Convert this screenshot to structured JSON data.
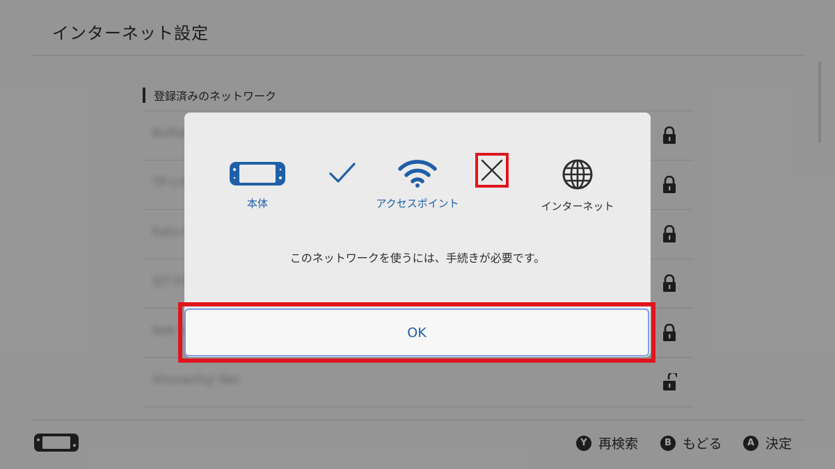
{
  "header": {
    "title": "インターネット設定"
  },
  "section": {
    "label": "登録済みのネットワーク"
  },
  "networks": [
    {
      "name": "Buffalo-G-XXXX",
      "lock": "locked"
    },
    {
      "name": "TP-Link_XXXX",
      "lock": "locked"
    },
    {
      "name": "Kato-Home",
      "lock": "locked"
    },
    {
      "name": "SJT-XXXX",
      "lock": "locked"
    },
    {
      "name": "Nak-XXXX",
      "lock": "locked"
    },
    {
      "name": "Shonanfuji Net",
      "lock": "unlocked"
    }
  ],
  "dialog": {
    "items": [
      {
        "label": "本体",
        "icon": "console-icon",
        "color": "#1f5fa8"
      },
      {
        "label": "",
        "icon": "checkmark-icon",
        "color": "#1f5fa8"
      },
      {
        "label": "アクセスポイント",
        "icon": "wifi-icon",
        "color": "#1f5fa8"
      },
      {
        "label": "",
        "icon": "cross-icon",
        "color": "#2d2d2d"
      },
      {
        "label": "インターネット",
        "icon": "globe-icon",
        "color": "#2d2d2d"
      }
    ],
    "message": "このネットワークを使うには、手続きが必要です。",
    "ok_label": "OK"
  },
  "footer": {
    "hints": [
      {
        "button": "Y",
        "label": "再検索"
      },
      {
        "button": "B",
        "label": "もどる"
      },
      {
        "button": "A",
        "label": "決定"
      }
    ]
  },
  "colors": {
    "accent": "#1f5fa8",
    "highlight": "#e0141e",
    "focus": "#7f9be8"
  }
}
